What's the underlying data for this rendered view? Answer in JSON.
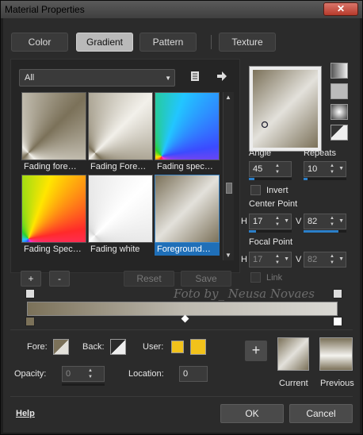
{
  "window": {
    "title": "Material Properties",
    "close_glyph": "✕"
  },
  "tabs": [
    {
      "label": "Color",
      "active": false
    },
    {
      "label": "Gradient",
      "active": true
    },
    {
      "label": "Pattern",
      "active": false
    },
    {
      "label": "Texture",
      "active": false
    }
  ],
  "category": {
    "selected": "All"
  },
  "library": {
    "items": [
      {
        "caption": "Fading fore…",
        "selected": false,
        "kind": "fade-fg"
      },
      {
        "caption": "Fading Fore…",
        "selected": false,
        "kind": "fade-fg2"
      },
      {
        "caption": "Fading spec…",
        "selected": false,
        "kind": "spectrum"
      },
      {
        "caption": "Fading Spec…",
        "selected": false,
        "kind": "spectrum2"
      },
      {
        "caption": "Fading white",
        "selected": false,
        "kind": "white"
      },
      {
        "caption": "Foreground…",
        "selected": true,
        "kind": "fg-bg"
      }
    ]
  },
  "buttons": {
    "add": "+",
    "remove": "-",
    "reset": "Reset",
    "save": "Save",
    "ok": "OK",
    "cancel": "Cancel",
    "help": "Help",
    "swap_plus": "+"
  },
  "angle": {
    "label": "Angle",
    "value": "45",
    "fill": 0.125
  },
  "repeats": {
    "label": "Repeats",
    "value": "10",
    "fill": 0.1
  },
  "invert": {
    "label": "Invert",
    "checked": false
  },
  "center_point": {
    "label": "Center Point",
    "h_label": "H",
    "h": "17",
    "v_label": "V",
    "v": "82"
  },
  "focal_point": {
    "label": "Focal Point",
    "h_label": "H",
    "h": "17",
    "v_label": "V",
    "v": "82",
    "enabled": false
  },
  "link": {
    "label": "Link",
    "checked": false,
    "enabled": false
  },
  "watermark": "Foto by_ Neusa Novaes",
  "bottom": {
    "fore_label": "Fore:",
    "back_label": "Back:",
    "user_label": "User:",
    "opacity_label": "Opacity:",
    "opacity_value": "0",
    "location_label": "Location:",
    "location_value": "0",
    "current_label": "Current",
    "previous_label": "Previous"
  },
  "colors": {
    "foreground": "#7b7159",
    "background": "#e3e1db",
    "user_swatch": "#f2c21b",
    "accent": "#2b7fc9"
  },
  "icons": {
    "library_icon": "library-icon",
    "arrow_icon": "arrow-right-icon"
  }
}
